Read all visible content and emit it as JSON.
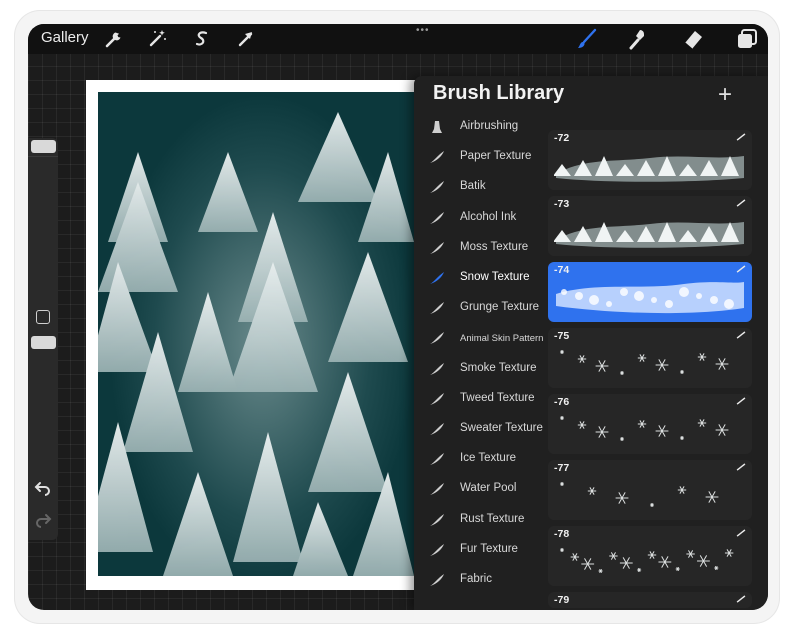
{
  "toolbar": {
    "gallery_label": "Gallery",
    "drag_handle": "•••",
    "left_tools": [
      "wrench-icon",
      "magic-wand-icon",
      "selection-icon",
      "transform-arrow-icon"
    ],
    "right_tools": [
      "brush-icon",
      "smudge-icon",
      "eraser-icon",
      "layers-icon"
    ],
    "active_tool": "brush-icon",
    "accent_color": "#2f72ee"
  },
  "sidebar": {
    "controls": [
      "size-slider",
      "modify-square",
      "opacity-slider",
      "undo-icon",
      "redo-icon"
    ]
  },
  "panel": {
    "title": "Brush Library",
    "add_label": "+",
    "categories": [
      {
        "label": "Airbrushing",
        "icon": "airbrush-icon"
      },
      {
        "label": "Paper Texture",
        "icon": "brush-stroke-icon"
      },
      {
        "label": "Batik",
        "icon": "brush-stroke-icon"
      },
      {
        "label": "Alcohol Ink",
        "icon": "brush-stroke-icon"
      },
      {
        "label": "Moss Texture",
        "icon": "brush-stroke-icon"
      },
      {
        "label": "Snow Texture",
        "icon": "brush-stroke-icon",
        "selected": true
      },
      {
        "label": "Grunge Texture",
        "icon": "brush-stroke-icon"
      },
      {
        "label": "Animal Skin Pattern",
        "icon": "brush-stroke-icon"
      },
      {
        "label": "Smoke Texture",
        "icon": "brush-stroke-icon"
      },
      {
        "label": "Tweed Texture",
        "icon": "brush-stroke-icon"
      },
      {
        "label": "Sweater Texture",
        "icon": "brush-stroke-icon"
      },
      {
        "label": "Ice Texture",
        "icon": "brush-stroke-icon"
      },
      {
        "label": "Water Pool",
        "icon": "brush-stroke-icon"
      },
      {
        "label": "Rust Texture",
        "icon": "brush-stroke-icon"
      },
      {
        "label": "Fur Texture",
        "icon": "brush-stroke-icon"
      },
      {
        "label": "Fabric",
        "icon": "brush-stroke-icon"
      }
    ],
    "brushes": [
      {
        "name": "-72",
        "preview": "snowy-trees"
      },
      {
        "name": "-73",
        "preview": "snowy-forest"
      },
      {
        "name": "-74",
        "preview": "snow-clouds",
        "selected": true
      },
      {
        "name": "-75",
        "preview": "snowflakes-large"
      },
      {
        "name": "-76",
        "preview": "snowflakes-scattered"
      },
      {
        "name": "-77",
        "preview": "snowflakes-sparse"
      },
      {
        "name": "-78",
        "preview": "snowflakes-dense"
      },
      {
        "name": "-79",
        "preview": "snowflakes"
      }
    ]
  },
  "canvas": {
    "subject": "snowy-forest-artwork"
  }
}
